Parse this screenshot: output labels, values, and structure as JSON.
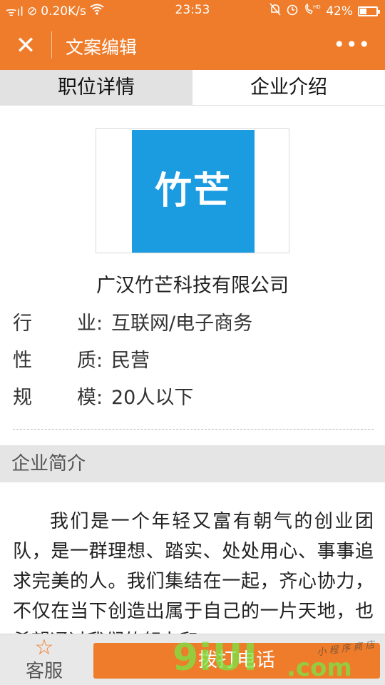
{
  "status_bar": {
    "signal": "ᯤıl",
    "net_speed": "0.20K/s",
    "time": "23:53",
    "battery": "42%",
    "battery_level_percent": 42,
    "icons": [
      "signal-icon",
      "block-icon",
      "wifi-icon",
      "mute-icon",
      "alarm-icon",
      "hd-call-icon",
      "battery-icon"
    ]
  },
  "nav": {
    "title": "文案编辑",
    "close_glyph": "✕",
    "more_glyph": "•••"
  },
  "tabs": [
    {
      "label": "职位详情",
      "active": false
    },
    {
      "label": "企业介绍",
      "active": true
    }
  ],
  "logo": {
    "text": "竹芒",
    "color": "#1b9be0"
  },
  "company": {
    "name": "广汉竹芒科技有限公司",
    "info": [
      {
        "k1": "行",
        "k2": "业:",
        "value": "互联网/电子商务"
      },
      {
        "k1": "性",
        "k2": "质:",
        "value": "民营"
      },
      {
        "k1": "规",
        "k2": "模:",
        "value": "20人以下"
      }
    ]
  },
  "section": {
    "title": "企业简介",
    "intro": "我们是一个年轻又富有朝气的创业团队，是一群理想、踏实、处处用心、事事追求完美的人。我们集结在一起，齐心协力，不仅在当下创造出属于自己的一片天地，也希望通过我们的努力和"
  },
  "bottom": {
    "service_label": "客服",
    "call_label": "拨打电话"
  },
  "watermark": {
    "big": "9iUI",
    "com": ".com",
    "small": "小 程 序 商 店"
  },
  "colors": {
    "accent": "#ee7c2a",
    "tab_inactive": "#e2e2e2",
    "section_bg": "#e5e5e5"
  }
}
